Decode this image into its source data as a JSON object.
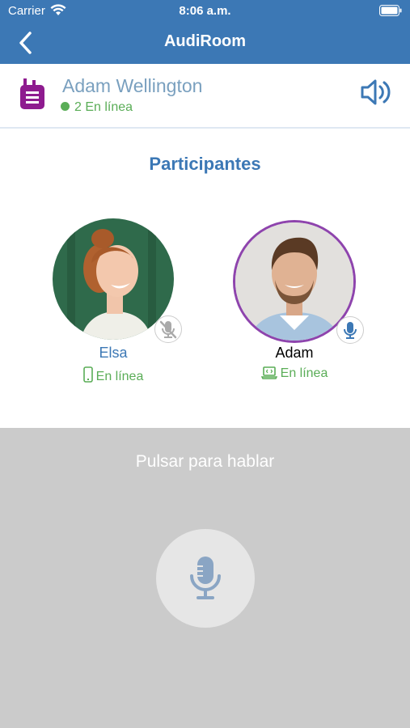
{
  "status_bar": {
    "carrier": "Carrier",
    "time": "8:06 a.m.",
    "icons": [
      "wifi-icon",
      "battery-icon"
    ]
  },
  "nav": {
    "title": "AudiRoom",
    "back_icon": "chevron-left-icon",
    "color": "#3c78b5"
  },
  "contact": {
    "name": "Adam Wellington",
    "online_text": "2 En línea",
    "icon": "walkie-talkie-icon",
    "icon_color": "#8e1b8f",
    "action_icon": "speaker-icon"
  },
  "participants_title": "Participantes",
  "participants": [
    {
      "name": "Elsa",
      "status": "En línea",
      "device_icon": "phone-icon",
      "mic_icon": "mic-muted-icon",
      "speaking": false
    },
    {
      "name": "Adam",
      "status": "En línea",
      "device_icon": "laptop-icon",
      "mic_icon": "mic-icon",
      "speaking": true,
      "ring_color": "#8e44ad"
    }
  ],
  "push_to_talk": {
    "label": "Pulsar para hablar",
    "button_icon": "microphone-icon"
  },
  "colors": {
    "accent": "#3c78b5",
    "online": "#5aad57",
    "panel": "#cbcbcb"
  }
}
